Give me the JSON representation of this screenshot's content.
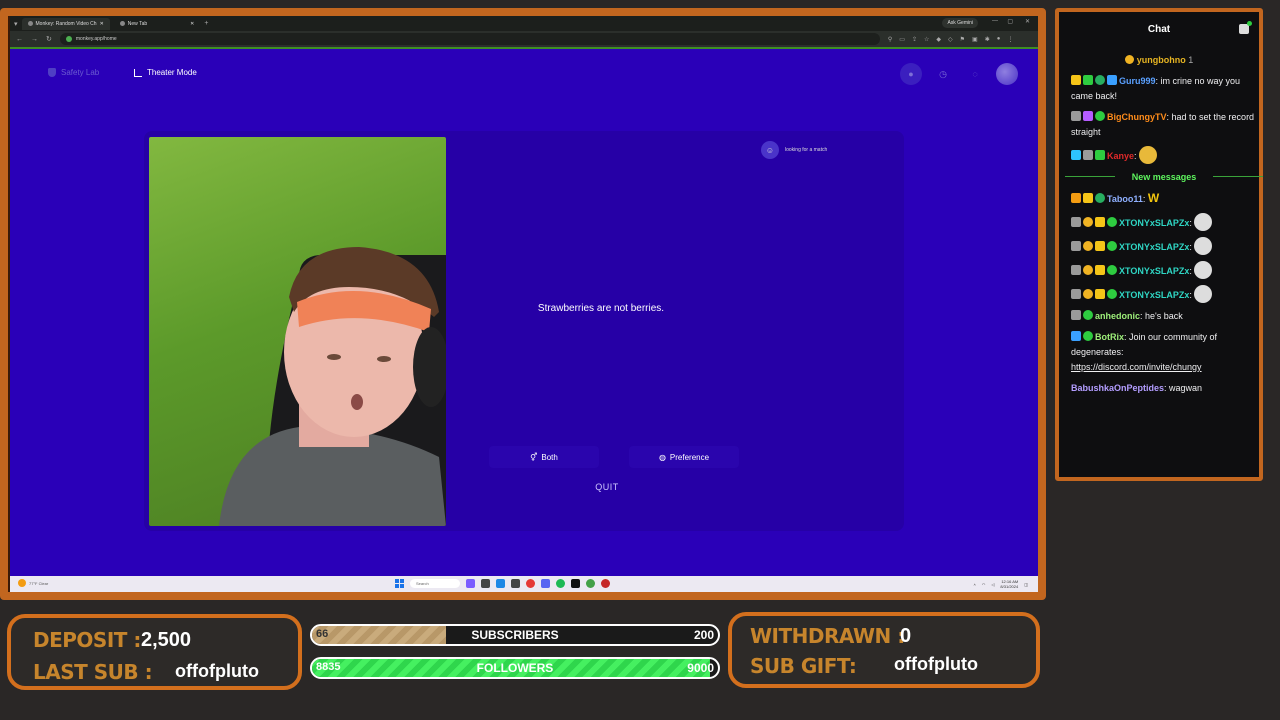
{
  "browser": {
    "tabs": [
      {
        "label": "Monkey: Random Video Ch",
        "active": true
      },
      {
        "label": "New Tab",
        "active": false
      }
    ],
    "new_tab_glyph": "+",
    "ask_gemini": "Ask Gemini",
    "url": "monkey.app/home"
  },
  "page": {
    "safety_lab": "Safety Lab",
    "theater_mode": "Theater Mode",
    "looking": "looking for a match",
    "fact": "Strawberries are not berries.",
    "options": [
      {
        "label": "Both",
        "icon": "people-icon"
      },
      {
        "label": "Preference",
        "icon": "globe-icon"
      }
    ],
    "quit": "QUIT"
  },
  "taskbar": {
    "weather": "77°F Clear",
    "search": "Search",
    "time": "12:16 AM",
    "date": "8/31/2024"
  },
  "chat": {
    "title": "Chat",
    "pinned_user": "yungbohno",
    "pinned_count": "1",
    "messages_before": [
      {
        "user": "Guru999",
        "color": "#5aa0ff",
        "text": "im crine no way you came back!"
      },
      {
        "user": "BigChungyTV",
        "color": "#ff8c1a",
        "text": "had to set the record straight"
      },
      {
        "user": "Kanye",
        "color": "#e02a2a",
        "text": ""
      }
    ],
    "new_messages_label": "New messages",
    "messages_after": [
      {
        "user": "Taboo11",
        "color": "#8fb0ff",
        "text": ""
      },
      {
        "user": "XTONYxSLAPZx",
        "color": "#2fd6c4",
        "text": ""
      },
      {
        "user": "XTONYxSLAPZx",
        "color": "#2fd6c4",
        "text": ""
      },
      {
        "user": "XTONYxSLAPZx",
        "color": "#2fd6c4",
        "text": ""
      },
      {
        "user": "XTONYxSLAPZx",
        "color": "#2fd6c4",
        "text": ""
      },
      {
        "user": "anhedonic",
        "color": "#9ef07a",
        "text": "he's back"
      },
      {
        "user": "BotRix",
        "color": "#9ef07a",
        "text": "Join our community of degenerates:"
      },
      {
        "user": "BabushkaOnPeptides",
        "color": "#b39dff",
        "text": "wagwan"
      }
    ],
    "botrix_link": "https://discord.com/invite/chungy"
  },
  "overlay": {
    "deposit_label": "DEPOSIT :",
    "deposit_value": "2,500",
    "last_sub_label": "LAST SUB :",
    "last_sub_value": "offofpluto",
    "subs": {
      "label": "SUBSCRIBERS",
      "current": "66",
      "goal": "200",
      "progress": 0.33
    },
    "followers": {
      "label": "FOLLOWERS",
      "current": "8835",
      "goal": "9000",
      "progress": 0.98
    },
    "withdrawn_label": "WITHDRAWN :",
    "withdrawn_value": "0",
    "sub_gift_label": "SUB GIFT:",
    "sub_gift_value": "offofpluto"
  },
  "colors": {
    "frame": "#c2661f",
    "page_bg": "#2a00b8",
    "label_gold": "#c7852c"
  }
}
